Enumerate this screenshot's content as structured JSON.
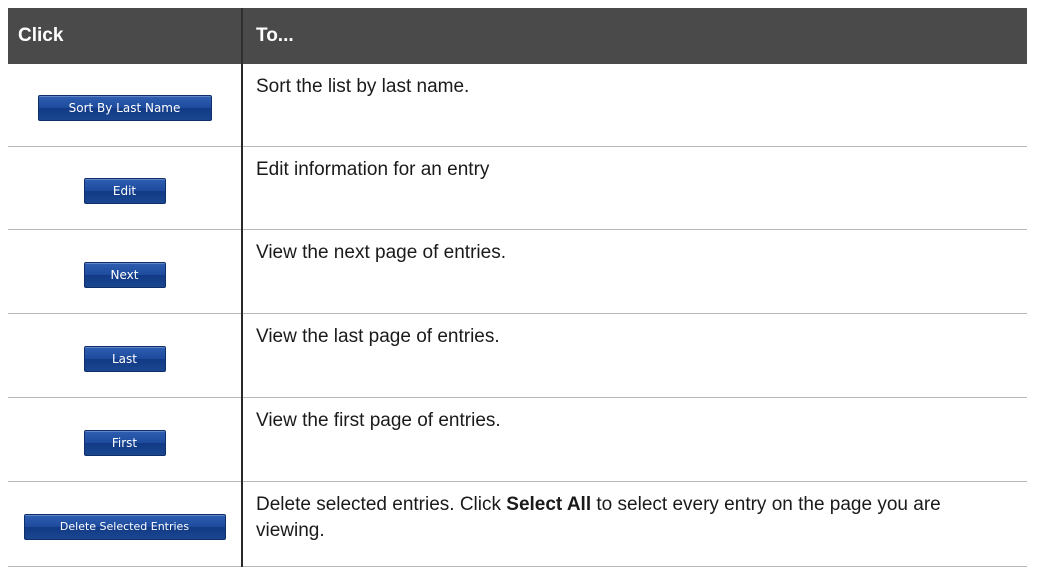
{
  "table": {
    "header_click": "Click",
    "header_to": "To...",
    "rows": [
      {
        "button": "Sort By Last Name",
        "description": "Sort the list by last name."
      },
      {
        "button": "Edit",
        "description": "Edit information for an entry"
      },
      {
        "button": "Next",
        "description": "View the next page of entries."
      },
      {
        "button": "Last",
        "description": "View the last page of entries."
      },
      {
        "button": "First",
        "description": "View the first page of entries."
      },
      {
        "button": "Delete Selected Entries",
        "description_before": "Delete selected entries. Click ",
        "description_bold": "Select All",
        "description_after": " to select every entry on the page you are viewing."
      }
    ]
  },
  "colors": {
    "header_bg": "#4a4a4a",
    "button_blue": "#1d4a9c"
  }
}
